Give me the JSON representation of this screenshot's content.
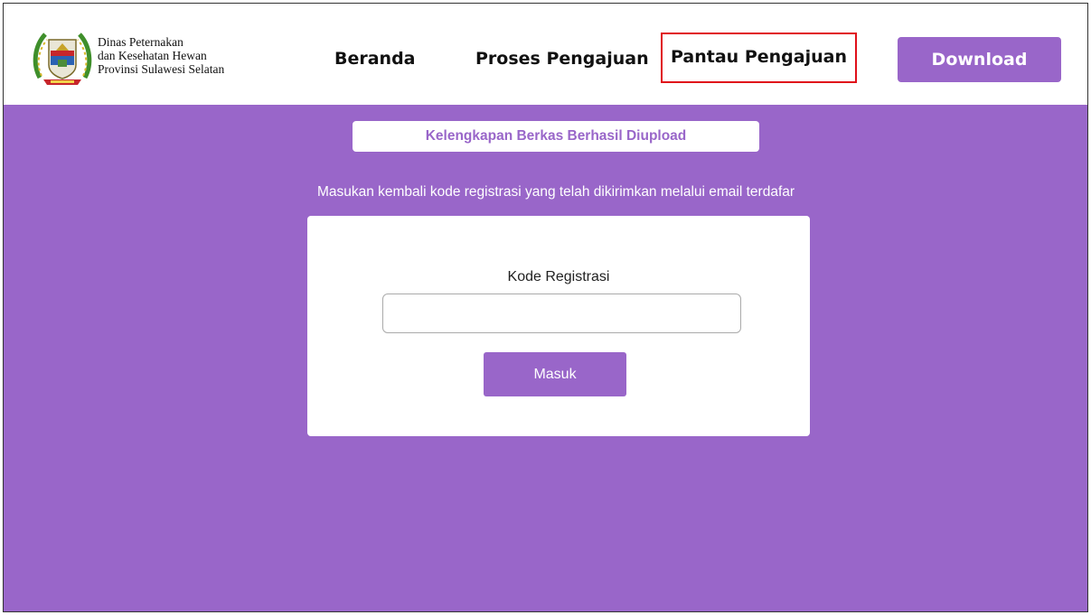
{
  "header": {
    "org_name_lines": [
      "Dinas Peternakan",
      "dan Kesehatan Hewan",
      "Provinsi Sulawesi Selatan"
    ],
    "logo_icon": "provincial-crest-icon",
    "nav": {
      "beranda": "Beranda",
      "proses": "Proses Pengajuan",
      "pantau": "Pantau Pengajuan"
    },
    "download_label": "Download"
  },
  "main": {
    "success_message": "Kelengkapan Berkas Berhasil Diupload",
    "instruction": "Masukan kembali kode registrasi yang telah dikirimkan melalui email terdafar",
    "form": {
      "label": "Kode Registrasi",
      "value": "",
      "placeholder": "",
      "submit_label": "Masuk"
    }
  },
  "colors": {
    "accent": "#9966c9",
    "highlight_border": "#e0101a"
  }
}
